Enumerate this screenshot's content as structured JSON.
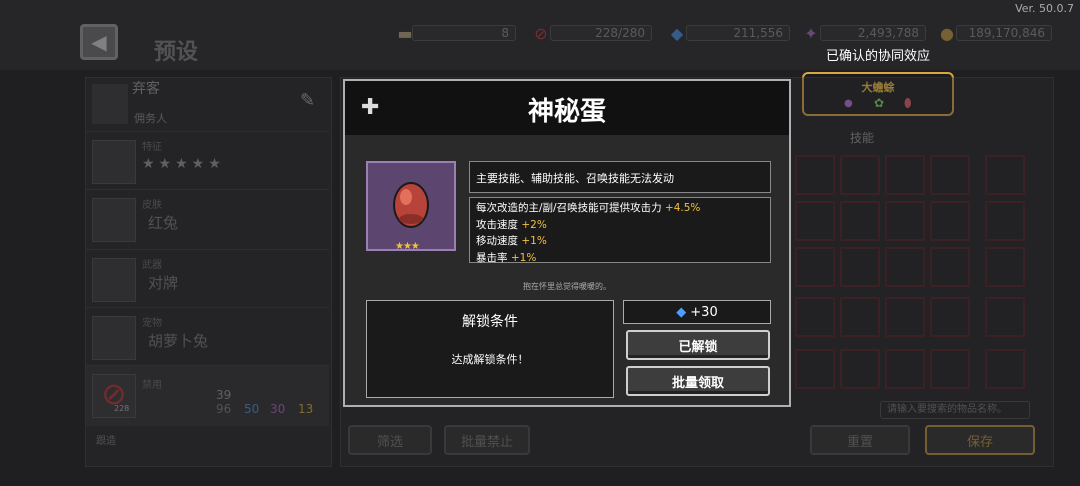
{
  "version": "Ver. 50.0.7",
  "header": {
    "title": "预设",
    "resources": [
      {
        "icon": "scroll-icon",
        "value": "8"
      },
      {
        "icon": "forbid-icon",
        "value": "228/280"
      },
      {
        "icon": "gem-icon",
        "value": "211,556"
      },
      {
        "icon": "crystal-icon",
        "value": "2,493,788"
      },
      {
        "icon": "coin-icon",
        "value": "189,170,846"
      }
    ]
  },
  "synergy": {
    "label": "已确认的协同效应",
    "name": "大蟾蜍"
  },
  "left_panel": {
    "name": "弃客",
    "class": "佣务人",
    "trait_label": "特征",
    "skin_label": "皮肤",
    "skin_value": "红兔",
    "weapon_label": "武器",
    "weapon_value": "对牌",
    "pet_label": "宠物",
    "pet_value": "胡萝卜兔",
    "ban_label": "禁用",
    "ban_count": "228",
    "ban_total": "39",
    "ban_stats": [
      "96",
      "50",
      "30",
      "13"
    ],
    "footer_label": "跟造"
  },
  "right_panel": {
    "tab_label": "技能",
    "search_placeholder": "请输入要搜索的物品名称。",
    "filter_button": "筛选",
    "batch_ban_button": "批量禁止",
    "reset_button": "重置",
    "save_button": "保存"
  },
  "modal": {
    "title": "神秘蛋",
    "restriction": "主要技能、辅助技能、召唤技能无法发动",
    "effects": [
      {
        "text": "每次改造的主/副/召唤技能可提供攻击力 ",
        "bonus": "+4.5%"
      },
      {
        "text": "攻击速度 ",
        "bonus": "+2%"
      },
      {
        "text": "移动速度 ",
        "bonus": "+1%"
      },
      {
        "text": "暴击率 ",
        "bonus": "+1%"
      }
    ],
    "flavor": "抱在怀里总觉得暖暖的。",
    "unlock_title": "解锁条件",
    "unlock_desc": "达成解锁条件！",
    "reward": "+30",
    "unlocked_button": "已解锁",
    "batch_claim_button": "批量领取",
    "rarity_stars": "★★★"
  },
  "colors": {
    "accent_gold": "#f0c040",
    "modal_border": "#b0b0b0",
    "egg_frame": "#5c4670"
  }
}
